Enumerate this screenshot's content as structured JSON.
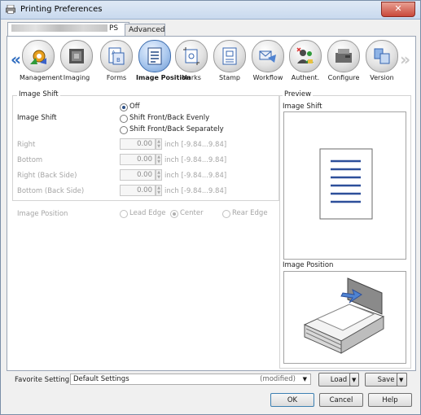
{
  "window": {
    "title": "Printing Preferences",
    "close_glyph": "✕"
  },
  "tabs": [
    {
      "label": "PS",
      "active": true
    },
    {
      "label": "Advanced",
      "active": false
    }
  ],
  "toolbar": {
    "prev_glyph": "«",
    "next_glyph": "»",
    "items": [
      {
        "label": "Management",
        "icon": "management-icon"
      },
      {
        "label": "Imaging",
        "icon": "imaging-icon"
      },
      {
        "label": "Forms",
        "icon": "forms-icon"
      },
      {
        "label": "Image Position",
        "icon": "image-position-icon",
        "selected": true
      },
      {
        "label": "Marks",
        "icon": "marks-icon"
      },
      {
        "label": "Stamp",
        "icon": "stamp-icon"
      },
      {
        "label": "Workflow",
        "icon": "workflow-icon"
      },
      {
        "label": "Authent.",
        "icon": "authentication-icon"
      },
      {
        "label": "Configure",
        "icon": "configure-icon"
      },
      {
        "label": "Version",
        "icon": "version-icon"
      }
    ]
  },
  "image_shift": {
    "group_label": "Image Shift",
    "field_label": "Image Shift",
    "options": [
      "Off",
      "Shift Front/Back Evenly",
      "Shift Front/Back Separately"
    ],
    "selected": "Off",
    "rows": [
      {
        "label": "Right",
        "value": "0.00",
        "unit": "inch [-9.84...9.84]"
      },
      {
        "label": "Bottom",
        "value": "0.00",
        "unit": "inch [-9.84...9.84]"
      },
      {
        "label": "Right (Back Side)",
        "value": "0.00",
        "unit": "inch [-9.84...9.84]"
      },
      {
        "label": "Bottom (Back Side)",
        "value": "0.00",
        "unit": "inch [-9.84...9.84]"
      }
    ]
  },
  "image_position": {
    "label": "Image Position",
    "options": [
      "Lead Edge",
      "Center",
      "Rear Edge"
    ],
    "selected": "Center"
  },
  "preview": {
    "group_label": "Preview",
    "shift_label": "Image Shift",
    "position_label": "Image Position"
  },
  "favorite": {
    "label": "Favorite Setting",
    "value": "Default Settings",
    "status": "(modified)",
    "load_label": "Load",
    "save_label": "Save"
  },
  "buttons": {
    "ok": "OK",
    "cancel": "Cancel",
    "help": "Help"
  },
  "colors": {
    "accent": "#2d6bbf",
    "selected_tool": "#aac8ee"
  }
}
